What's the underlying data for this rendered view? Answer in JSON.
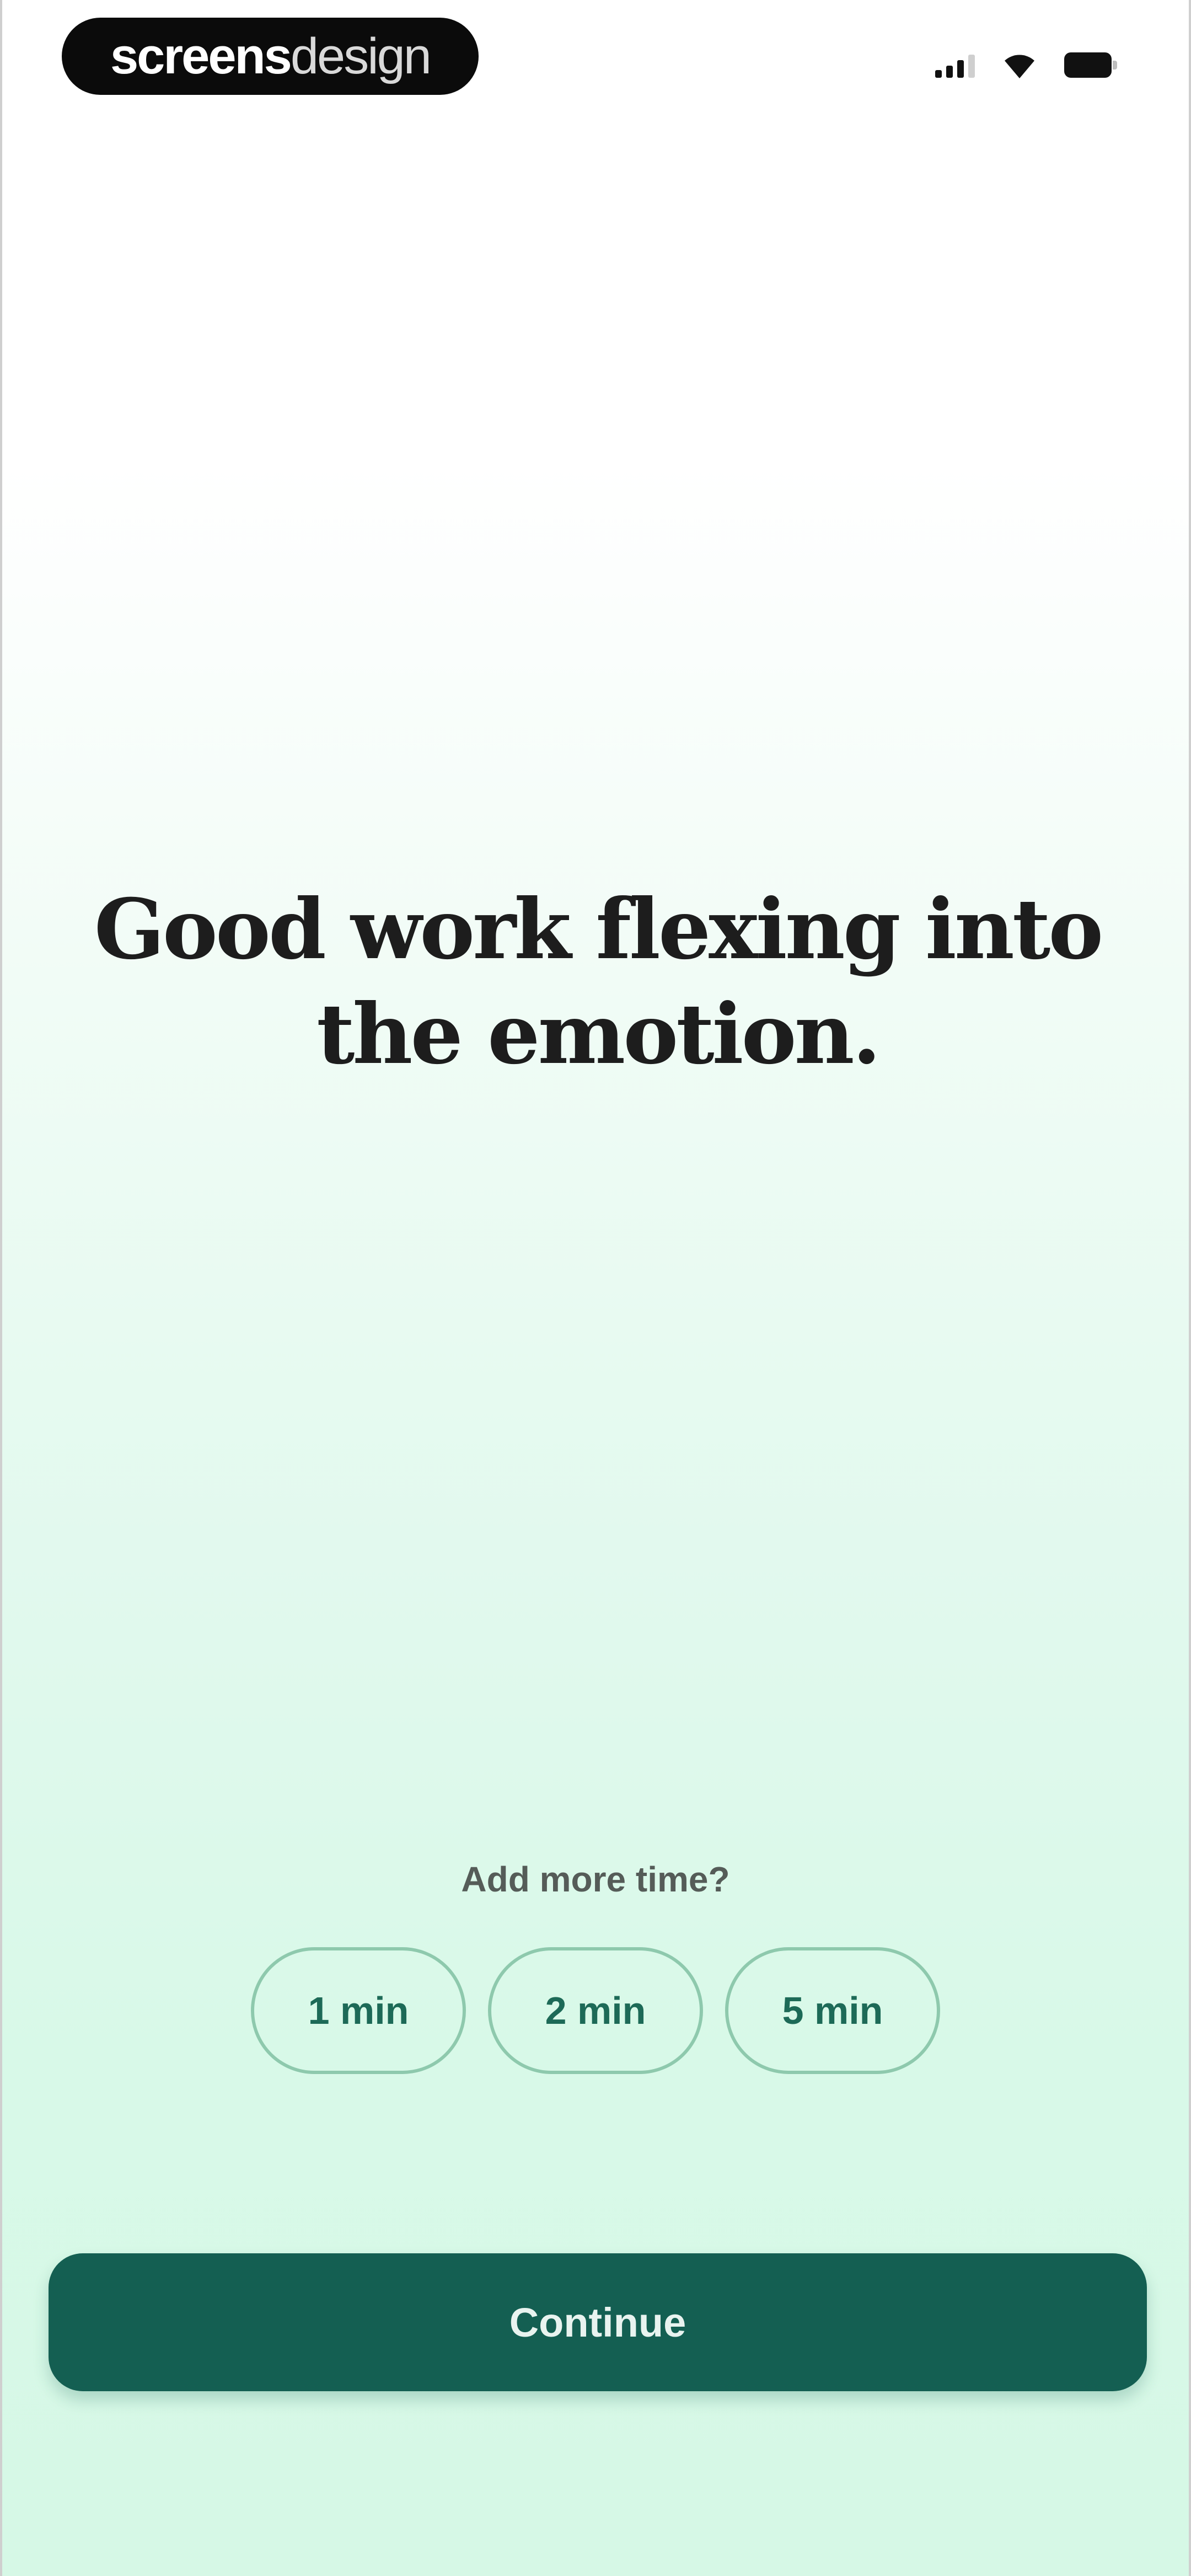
{
  "brand": {
    "part1": "screens",
    "part2": "design"
  },
  "status_bar": {
    "signal_icon": "signal-bars-icon",
    "wifi_icon": "wifi-icon",
    "battery_icon": "battery-icon"
  },
  "headline": "Good work flexing into the emotion.",
  "add_time": {
    "label": "Add more time?",
    "options": [
      "1 min",
      "2 min",
      "5 min"
    ]
  },
  "continue_label": "Continue",
  "colors": {
    "accent": "#145f52",
    "chip_border": "#8ec9ad",
    "chip_text": "#1d6a57",
    "background_bottom": "#d6f8e6"
  }
}
